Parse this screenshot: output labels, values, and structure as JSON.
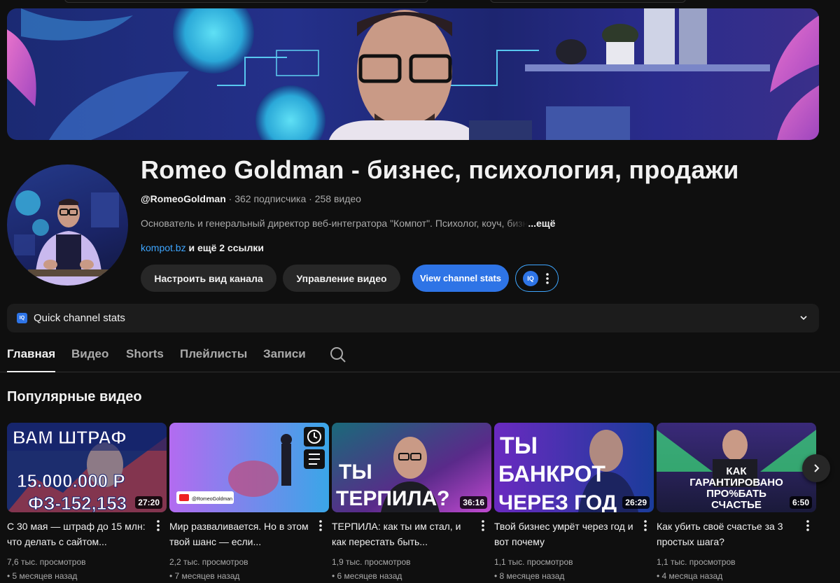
{
  "channel": {
    "title": "Romeo Goldman - бизнес, психология, продажи",
    "handle": "@RomeoGoldman",
    "stats": " · 362 подписчика · 258 видео",
    "description": "Основатель и генеральный директор веб-интегратора \"Компот\". Психолог, коуч, ",
    "description_fade": "бизн",
    "more": "...ещё",
    "link": "kompot.bz",
    "links_more": " и ещё 2 ссылки"
  },
  "buttons": {
    "customize": "Настроить вид канала",
    "manage": "Управление видео",
    "stats": "View channel stats",
    "iq": "IQ"
  },
  "quick_stats": {
    "badge": "IQ",
    "label": "Quick channel stats"
  },
  "tabs": [
    "Главная",
    "Видео",
    "Shorts",
    "Плейлисты",
    "Записи"
  ],
  "section_title": "Популярные видео",
  "videos": [
    {
      "title": "С 30 мая — штраф до 15 млн: что делать с сайтом...",
      "duration": "27:20",
      "views": "7,6 тыс. просмотров",
      "ago": "• 5 месяцев назад",
      "thumb_text": [
        "ВАМ ШТРАФ",
        "15.000.000 Р",
        "ФЗ-152,153"
      ]
    },
    {
      "title": "Мир разваливается. Но в этом твой шанс — если...",
      "duration": "",
      "views": "2,2 тыс. просмотров",
      "ago": "• 7 месяцев назад",
      "thumb_text": [
        "@RomeoGoldman"
      ]
    },
    {
      "title": "ТЕРПИЛА: как ты им стал, и как перестать быть...",
      "duration": "36:16",
      "views": "1,9 тыс. просмотров",
      "ago": "• 6 месяцев назад",
      "thumb_text": [
        "ТЫ",
        "ТЕРПИЛА?"
      ]
    },
    {
      "title": "Твой бизнес умрёт через год и вот почему",
      "duration": "26:29",
      "views": "1,1 тыс. просмотров",
      "ago": "• 8 месяцев назад",
      "thumb_text": [
        "ТЫ",
        "БАНКРОТ",
        "ЧЕРЕЗ ГОД"
      ]
    },
    {
      "title": "Как убить своё счастье за 3 простых шага?",
      "duration": "6:50",
      "views": "1,1 тыс. просмотров",
      "ago": "• 4 месяца назад",
      "thumb_text": [
        "КАК",
        "ГАРАНТИРОВАНО",
        "ПРО%БАТЬ",
        "СЧАСТЬЕ"
      ]
    }
  ],
  "colors": {
    "accent": "#2e74e6",
    "link": "#3ea6ff",
    "background": "#0f0f0f"
  }
}
